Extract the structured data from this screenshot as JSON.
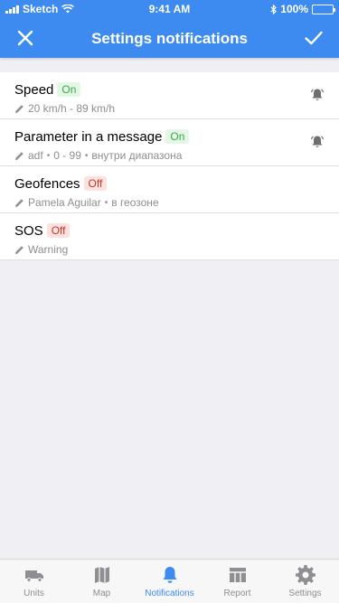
{
  "status_bar": {
    "carrier": "Sketch",
    "time": "9:41 AM",
    "battery": "100%"
  },
  "header": {
    "title": "Settings notifications",
    "close_icon": "close-icon",
    "confirm_icon": "checkmark-icon"
  },
  "notifications": [
    {
      "name": "Speed",
      "status": "On",
      "details": [
        "20 km/h - 89 km/h"
      ],
      "muted_bell": true
    },
    {
      "name": "Parameter in a message",
      "status": "On",
      "details": [
        "adf",
        "0 - 99",
        "внутри диапазона"
      ],
      "muted_bell": true
    },
    {
      "name": "Geofences",
      "status": "Off",
      "details": [
        "Pamela Aguilar",
        "в геозоне"
      ],
      "muted_bell": false
    },
    {
      "name": "SOS",
      "status": "Off",
      "details": [
        "Warning"
      ],
      "muted_bell": false
    }
  ],
  "tabs": [
    {
      "label": "Units",
      "icon": "truck-icon",
      "active": false
    },
    {
      "label": "Map",
      "icon": "map-icon",
      "active": false
    },
    {
      "label": "Notifications",
      "icon": "bell-icon",
      "active": true
    },
    {
      "label": "Report",
      "icon": "table-icon",
      "active": false
    },
    {
      "label": "Settings",
      "icon": "gear-icon",
      "active": false
    }
  ],
  "colors": {
    "accent": "#3d8bf0",
    "on_badge_bg": "#e2f7e4",
    "on_badge_text": "#3ba64a",
    "off_badge_bg": "#fde1df",
    "off_badge_text": "#c0392b",
    "background": "#efeff4"
  }
}
